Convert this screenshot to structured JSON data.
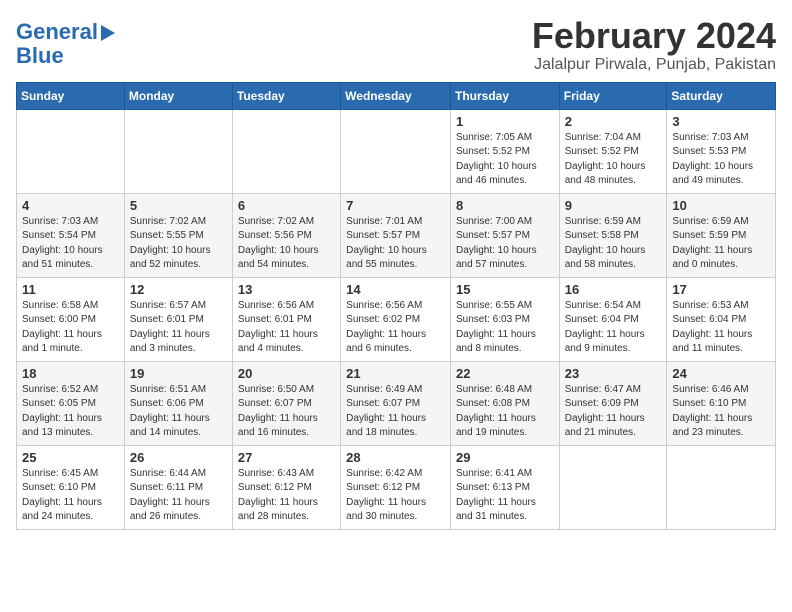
{
  "logo": {
    "line1": "General",
    "line2": "Blue"
  },
  "title": "February 2024",
  "subtitle": "Jalalpur Pirwala, Punjab, Pakistan",
  "days_of_week": [
    "Sunday",
    "Monday",
    "Tuesday",
    "Wednesday",
    "Thursday",
    "Friday",
    "Saturday"
  ],
  "weeks": [
    [
      {
        "day": "",
        "info": ""
      },
      {
        "day": "",
        "info": ""
      },
      {
        "day": "",
        "info": ""
      },
      {
        "day": "",
        "info": ""
      },
      {
        "day": "1",
        "info": "Sunrise: 7:05 AM\nSunset: 5:52 PM\nDaylight: 10 hours\nand 46 minutes."
      },
      {
        "day": "2",
        "info": "Sunrise: 7:04 AM\nSunset: 5:52 PM\nDaylight: 10 hours\nand 48 minutes."
      },
      {
        "day": "3",
        "info": "Sunrise: 7:03 AM\nSunset: 5:53 PM\nDaylight: 10 hours\nand 49 minutes."
      }
    ],
    [
      {
        "day": "4",
        "info": "Sunrise: 7:03 AM\nSunset: 5:54 PM\nDaylight: 10 hours\nand 51 minutes."
      },
      {
        "day": "5",
        "info": "Sunrise: 7:02 AM\nSunset: 5:55 PM\nDaylight: 10 hours\nand 52 minutes."
      },
      {
        "day": "6",
        "info": "Sunrise: 7:02 AM\nSunset: 5:56 PM\nDaylight: 10 hours\nand 54 minutes."
      },
      {
        "day": "7",
        "info": "Sunrise: 7:01 AM\nSunset: 5:57 PM\nDaylight: 10 hours\nand 55 minutes."
      },
      {
        "day": "8",
        "info": "Sunrise: 7:00 AM\nSunset: 5:57 PM\nDaylight: 10 hours\nand 57 minutes."
      },
      {
        "day": "9",
        "info": "Sunrise: 6:59 AM\nSunset: 5:58 PM\nDaylight: 10 hours\nand 58 minutes."
      },
      {
        "day": "10",
        "info": "Sunrise: 6:59 AM\nSunset: 5:59 PM\nDaylight: 11 hours\nand 0 minutes."
      }
    ],
    [
      {
        "day": "11",
        "info": "Sunrise: 6:58 AM\nSunset: 6:00 PM\nDaylight: 11 hours\nand 1 minute."
      },
      {
        "day": "12",
        "info": "Sunrise: 6:57 AM\nSunset: 6:01 PM\nDaylight: 11 hours\nand 3 minutes."
      },
      {
        "day": "13",
        "info": "Sunrise: 6:56 AM\nSunset: 6:01 PM\nDaylight: 11 hours\nand 4 minutes."
      },
      {
        "day": "14",
        "info": "Sunrise: 6:56 AM\nSunset: 6:02 PM\nDaylight: 11 hours\nand 6 minutes."
      },
      {
        "day": "15",
        "info": "Sunrise: 6:55 AM\nSunset: 6:03 PM\nDaylight: 11 hours\nand 8 minutes."
      },
      {
        "day": "16",
        "info": "Sunrise: 6:54 AM\nSunset: 6:04 PM\nDaylight: 11 hours\nand 9 minutes."
      },
      {
        "day": "17",
        "info": "Sunrise: 6:53 AM\nSunset: 6:04 PM\nDaylight: 11 hours\nand 11 minutes."
      }
    ],
    [
      {
        "day": "18",
        "info": "Sunrise: 6:52 AM\nSunset: 6:05 PM\nDaylight: 11 hours\nand 13 minutes."
      },
      {
        "day": "19",
        "info": "Sunrise: 6:51 AM\nSunset: 6:06 PM\nDaylight: 11 hours\nand 14 minutes."
      },
      {
        "day": "20",
        "info": "Sunrise: 6:50 AM\nSunset: 6:07 PM\nDaylight: 11 hours\nand 16 minutes."
      },
      {
        "day": "21",
        "info": "Sunrise: 6:49 AM\nSunset: 6:07 PM\nDaylight: 11 hours\nand 18 minutes."
      },
      {
        "day": "22",
        "info": "Sunrise: 6:48 AM\nSunset: 6:08 PM\nDaylight: 11 hours\nand 19 minutes."
      },
      {
        "day": "23",
        "info": "Sunrise: 6:47 AM\nSunset: 6:09 PM\nDaylight: 11 hours\nand 21 minutes."
      },
      {
        "day": "24",
        "info": "Sunrise: 6:46 AM\nSunset: 6:10 PM\nDaylight: 11 hours\nand 23 minutes."
      }
    ],
    [
      {
        "day": "25",
        "info": "Sunrise: 6:45 AM\nSunset: 6:10 PM\nDaylight: 11 hours\nand 24 minutes."
      },
      {
        "day": "26",
        "info": "Sunrise: 6:44 AM\nSunset: 6:11 PM\nDaylight: 11 hours\nand 26 minutes."
      },
      {
        "day": "27",
        "info": "Sunrise: 6:43 AM\nSunset: 6:12 PM\nDaylight: 11 hours\nand 28 minutes."
      },
      {
        "day": "28",
        "info": "Sunrise: 6:42 AM\nSunset: 6:12 PM\nDaylight: 11 hours\nand 30 minutes."
      },
      {
        "day": "29",
        "info": "Sunrise: 6:41 AM\nSunset: 6:13 PM\nDaylight: 11 hours\nand 31 minutes."
      },
      {
        "day": "",
        "info": ""
      },
      {
        "day": "",
        "info": ""
      }
    ]
  ]
}
